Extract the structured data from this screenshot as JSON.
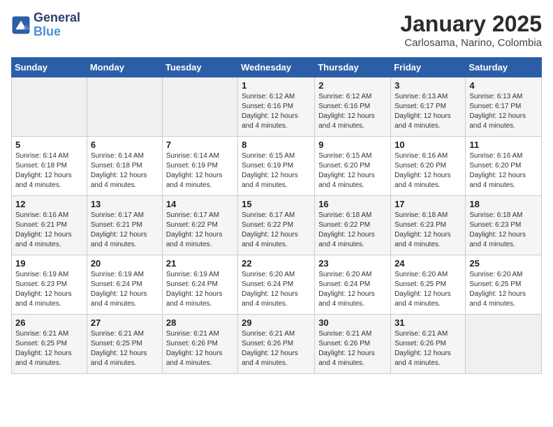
{
  "logo": {
    "line1": "General",
    "line2": "Blue"
  },
  "title": "January 2025",
  "subtitle": "Carlosama, Narino, Colombia",
  "weekdays": [
    "Sunday",
    "Monday",
    "Tuesday",
    "Wednesday",
    "Thursday",
    "Friday",
    "Saturday"
  ],
  "weeks": [
    [
      {
        "day": "",
        "info": ""
      },
      {
        "day": "",
        "info": ""
      },
      {
        "day": "",
        "info": ""
      },
      {
        "day": "1",
        "info": "Sunrise: 6:12 AM\nSunset: 6:16 PM\nDaylight: 12 hours and 4 minutes."
      },
      {
        "day": "2",
        "info": "Sunrise: 6:12 AM\nSunset: 6:16 PM\nDaylight: 12 hours and 4 minutes."
      },
      {
        "day": "3",
        "info": "Sunrise: 6:13 AM\nSunset: 6:17 PM\nDaylight: 12 hours and 4 minutes."
      },
      {
        "day": "4",
        "info": "Sunrise: 6:13 AM\nSunset: 6:17 PM\nDaylight: 12 hours and 4 minutes."
      }
    ],
    [
      {
        "day": "5",
        "info": "Sunrise: 6:14 AM\nSunset: 6:18 PM\nDaylight: 12 hours and 4 minutes."
      },
      {
        "day": "6",
        "info": "Sunrise: 6:14 AM\nSunset: 6:18 PM\nDaylight: 12 hours and 4 minutes."
      },
      {
        "day": "7",
        "info": "Sunrise: 6:14 AM\nSunset: 6:19 PM\nDaylight: 12 hours and 4 minutes."
      },
      {
        "day": "8",
        "info": "Sunrise: 6:15 AM\nSunset: 6:19 PM\nDaylight: 12 hours and 4 minutes."
      },
      {
        "day": "9",
        "info": "Sunrise: 6:15 AM\nSunset: 6:20 PM\nDaylight: 12 hours and 4 minutes."
      },
      {
        "day": "10",
        "info": "Sunrise: 6:16 AM\nSunset: 6:20 PM\nDaylight: 12 hours and 4 minutes."
      },
      {
        "day": "11",
        "info": "Sunrise: 6:16 AM\nSunset: 6:20 PM\nDaylight: 12 hours and 4 minutes."
      }
    ],
    [
      {
        "day": "12",
        "info": "Sunrise: 6:16 AM\nSunset: 6:21 PM\nDaylight: 12 hours and 4 minutes."
      },
      {
        "day": "13",
        "info": "Sunrise: 6:17 AM\nSunset: 6:21 PM\nDaylight: 12 hours and 4 minutes."
      },
      {
        "day": "14",
        "info": "Sunrise: 6:17 AM\nSunset: 6:22 PM\nDaylight: 12 hours and 4 minutes."
      },
      {
        "day": "15",
        "info": "Sunrise: 6:17 AM\nSunset: 6:22 PM\nDaylight: 12 hours and 4 minutes."
      },
      {
        "day": "16",
        "info": "Sunrise: 6:18 AM\nSunset: 6:22 PM\nDaylight: 12 hours and 4 minutes."
      },
      {
        "day": "17",
        "info": "Sunrise: 6:18 AM\nSunset: 6:23 PM\nDaylight: 12 hours and 4 minutes."
      },
      {
        "day": "18",
        "info": "Sunrise: 6:18 AM\nSunset: 6:23 PM\nDaylight: 12 hours and 4 minutes."
      }
    ],
    [
      {
        "day": "19",
        "info": "Sunrise: 6:19 AM\nSunset: 6:23 PM\nDaylight: 12 hours and 4 minutes."
      },
      {
        "day": "20",
        "info": "Sunrise: 6:19 AM\nSunset: 6:24 PM\nDaylight: 12 hours and 4 minutes."
      },
      {
        "day": "21",
        "info": "Sunrise: 6:19 AM\nSunset: 6:24 PM\nDaylight: 12 hours and 4 minutes."
      },
      {
        "day": "22",
        "info": "Sunrise: 6:20 AM\nSunset: 6:24 PM\nDaylight: 12 hours and 4 minutes."
      },
      {
        "day": "23",
        "info": "Sunrise: 6:20 AM\nSunset: 6:24 PM\nDaylight: 12 hours and 4 minutes."
      },
      {
        "day": "24",
        "info": "Sunrise: 6:20 AM\nSunset: 6:25 PM\nDaylight: 12 hours and 4 minutes."
      },
      {
        "day": "25",
        "info": "Sunrise: 6:20 AM\nSunset: 6:25 PM\nDaylight: 12 hours and 4 minutes."
      }
    ],
    [
      {
        "day": "26",
        "info": "Sunrise: 6:21 AM\nSunset: 6:25 PM\nDaylight: 12 hours and 4 minutes."
      },
      {
        "day": "27",
        "info": "Sunrise: 6:21 AM\nSunset: 6:25 PM\nDaylight: 12 hours and 4 minutes."
      },
      {
        "day": "28",
        "info": "Sunrise: 6:21 AM\nSunset: 6:26 PM\nDaylight: 12 hours and 4 minutes."
      },
      {
        "day": "29",
        "info": "Sunrise: 6:21 AM\nSunset: 6:26 PM\nDaylight: 12 hours and 4 minutes."
      },
      {
        "day": "30",
        "info": "Sunrise: 6:21 AM\nSunset: 6:26 PM\nDaylight: 12 hours and 4 minutes."
      },
      {
        "day": "31",
        "info": "Sunrise: 6:21 AM\nSunset: 6:26 PM\nDaylight: 12 hours and 4 minutes."
      },
      {
        "day": "",
        "info": ""
      }
    ]
  ]
}
